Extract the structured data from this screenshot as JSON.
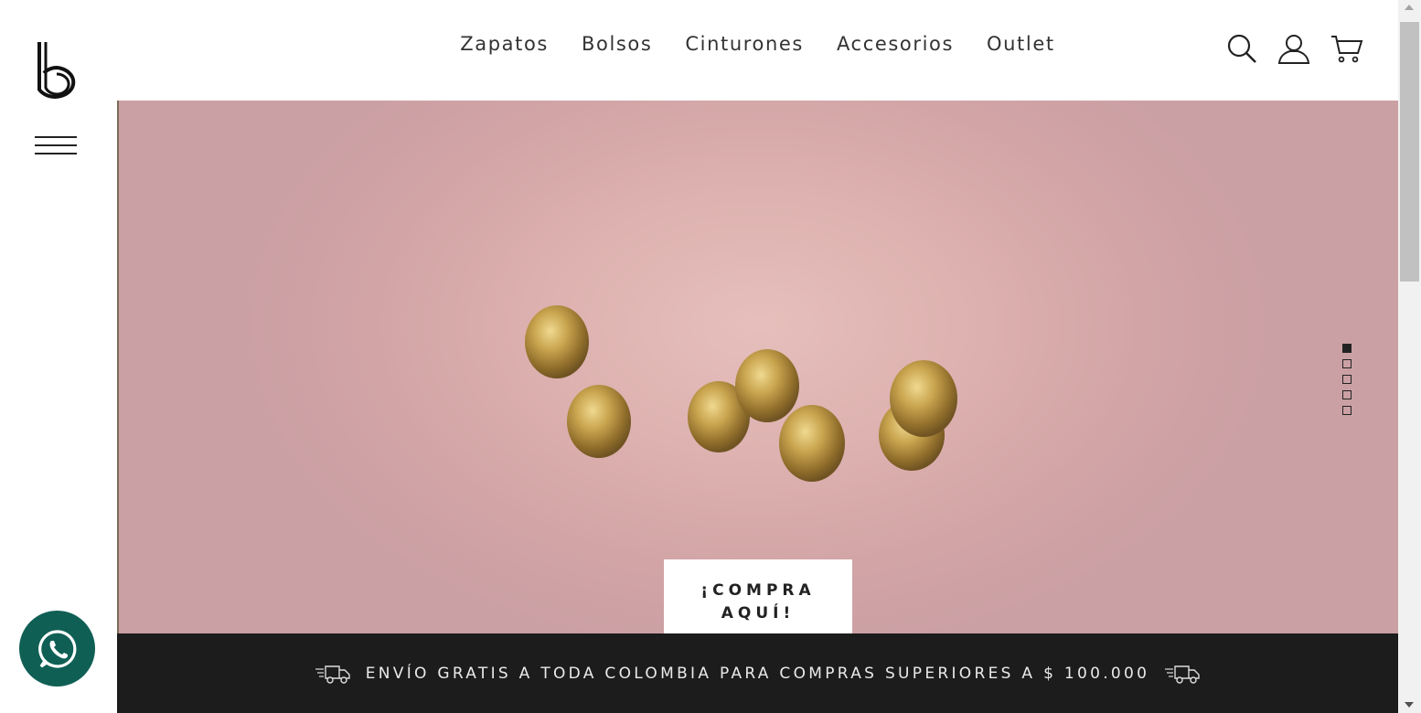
{
  "brand": {
    "logo_icon": "b-logo",
    "menu_icon": "hamburger-icon"
  },
  "nav": {
    "items": [
      {
        "label": "Zapatos"
      },
      {
        "label": "Bolsos"
      },
      {
        "label": "Cinturones"
      },
      {
        "label": "Accesorios"
      },
      {
        "label": "Outlet"
      }
    ]
  },
  "header_icons": [
    "search-icon",
    "user-icon",
    "cart-icon"
  ],
  "hero": {
    "cta_label": "¡COMPRA AQUÍ!",
    "slides_total": 5,
    "active_slide": 1,
    "background_color": "#dcb0ae",
    "egg_color": "#b8923a"
  },
  "shipping_bar": {
    "text": "ENVÍO GRATIS A TODA COLOMBIA PARA COMPRAS SUPERIORES A $ 100.000",
    "icon": "delivery-truck-icon"
  },
  "whatsapp": {
    "icon": "whatsapp-icon",
    "color": "#0f5f55"
  }
}
